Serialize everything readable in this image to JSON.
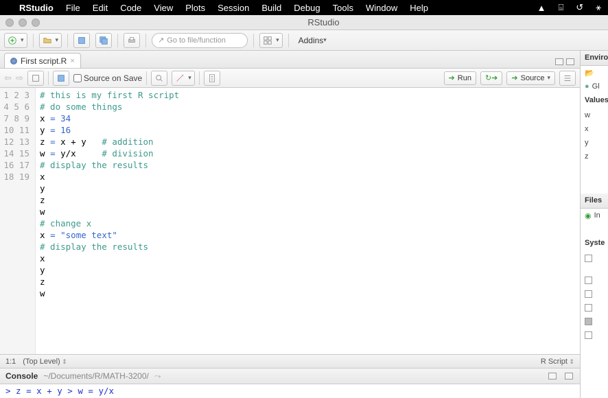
{
  "menubar": {
    "appname": "RStudio",
    "items": [
      "File",
      "Edit",
      "Code",
      "View",
      "Plots",
      "Session",
      "Build",
      "Debug",
      "Tools",
      "Window",
      "Help"
    ]
  },
  "window_title": "RStudio",
  "toolbar": {
    "goto_placeholder": "Go to file/function",
    "addins_label": "Addins"
  },
  "source": {
    "tab_name": "First script.R",
    "source_on_save_label": "Source on Save",
    "run_label": "Run",
    "source_button_label": "Source",
    "cursor_pos": "1:1",
    "scope": "(Top Level)",
    "lang": "R Script",
    "lines": [
      {
        "n": 1,
        "t": "comment",
        "text": "# this is my first R script"
      },
      {
        "n": 2,
        "t": "comment",
        "text": "# do some things"
      },
      {
        "n": 3,
        "t": "assign",
        "lhs": "x",
        "rhs": "34",
        "rhs_t": "num"
      },
      {
        "n": 4,
        "t": "assign",
        "lhs": "y",
        "rhs": "16",
        "rhs_t": "num"
      },
      {
        "n": 5,
        "t": "assign",
        "lhs": "z",
        "rhs": "x + y",
        "rhs_t": "expr",
        "trail": "   # addition"
      },
      {
        "n": 6,
        "t": "assign",
        "lhs": "w",
        "rhs": "y/x",
        "rhs_t": "expr",
        "trail": "     # division"
      },
      {
        "n": 7,
        "t": "comment",
        "text": "# display the results"
      },
      {
        "n": 8,
        "t": "plain",
        "text": "x"
      },
      {
        "n": 9,
        "t": "plain",
        "text": "y"
      },
      {
        "n": 10,
        "t": "plain",
        "text": "z"
      },
      {
        "n": 11,
        "t": "plain",
        "text": "w"
      },
      {
        "n": 12,
        "t": "comment",
        "text": "# change x"
      },
      {
        "n": 13,
        "t": "assign",
        "lhs": "x",
        "rhs": "\"some text\"",
        "rhs_t": "str"
      },
      {
        "n": 14,
        "t": "comment",
        "text": "# display the results"
      },
      {
        "n": 15,
        "t": "plain",
        "text": "x"
      },
      {
        "n": 16,
        "t": "plain",
        "text": "y"
      },
      {
        "n": 17,
        "t": "plain",
        "text": "z"
      },
      {
        "n": 18,
        "t": "plain",
        "text": "w"
      },
      {
        "n": 19,
        "t": "plain",
        "text": ""
      }
    ]
  },
  "console": {
    "tab_label": "Console",
    "path": "~/Documents/R/MATH-3200/",
    "lines": [
      "> z = x + y",
      "> w = y/x"
    ]
  },
  "right": {
    "env_label": "Enviro",
    "global_label": "Gl",
    "values_label": "Values",
    "vars": [
      "w",
      "x",
      "y",
      "z"
    ],
    "files_label": "Files",
    "install_label": "In",
    "system_label": "Syste"
  }
}
